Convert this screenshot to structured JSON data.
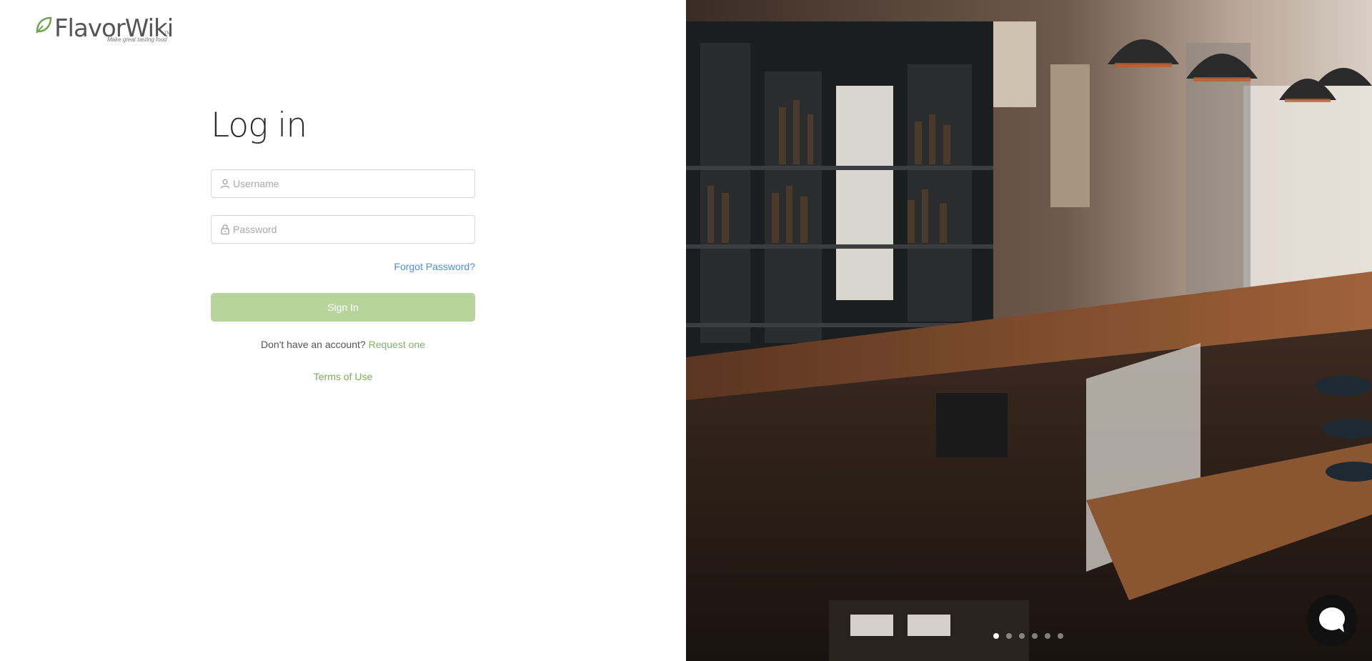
{
  "brand": {
    "name": "FlavorWiki",
    "tm": "TM",
    "tagline": "Make great tasting food",
    "accent": "#79ad57"
  },
  "login": {
    "title": "Log in",
    "username_placeholder": "Username",
    "password_placeholder": "Password",
    "forgot_label": "Forgot Password?",
    "signin_label": "Sign In",
    "no_account_text": "Don't have an account? ",
    "request_label": "Request one",
    "terms_label": "Terms of Use"
  },
  "carousel": {
    "slide_count": 6,
    "active_index": 0
  },
  "icons": {
    "username": "user-icon",
    "password": "lock-icon",
    "chat": "chat-bubble-icon",
    "logo": "leaf-icon"
  },
  "colors": {
    "button_bg": "#b7d49a",
    "link_blue": "#4a8fe8",
    "link_green": "#79ad57"
  }
}
